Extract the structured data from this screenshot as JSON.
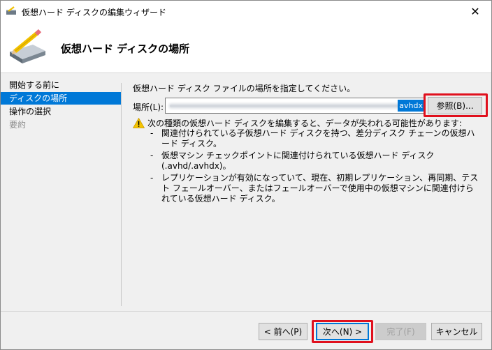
{
  "window": {
    "title": "仮想ハード ディスクの編集ウィザード",
    "close_glyph": "✕"
  },
  "header": {
    "title": "仮想ハード ディスクの場所"
  },
  "nav": {
    "items": [
      {
        "label": "開始する前に",
        "state": "normal"
      },
      {
        "label": "ディスクの場所",
        "state": "active"
      },
      {
        "label": "操作の選択",
        "state": "normal"
      },
      {
        "label": "要約",
        "state": "disabled"
      }
    ]
  },
  "content": {
    "instruction": "仮想ハード ディスク ファイルの場所を指定してください。",
    "location_label": "場所(L):",
    "location_value_visible": "avhdx",
    "browse_label": "参照(B)...",
    "warning": "次の種類の仮想ハード ディスクを編集すると、データが失われる可能性があります:",
    "bullets": [
      "関連付けられている子仮想ハード ディスクを持つ、差分ディスク チェーンの仮想ハード ディスク。",
      "仮想マシン チェックポイントに関連付けられている仮想ハード ディスク (.avhd/.avhdx)。",
      "レプリケーションが有効になっていて、現在、初期レプリケーション、再同期、テスト フェールオーバー、またはフェールオーバーで使用中の仮想マシンに関連付けられている仮想ハード ディスク。"
    ],
    "bullet_dash": "-"
  },
  "footer": {
    "prev_label": "< 前へ(P)",
    "next_label": "次へ(N) >",
    "finish_label": "完了(F)",
    "cancel_label": "キャンセル"
  },
  "colors": {
    "accent": "#0078d7",
    "highlight_red": "#e0101d",
    "warning_yellow": "#f5c400"
  }
}
